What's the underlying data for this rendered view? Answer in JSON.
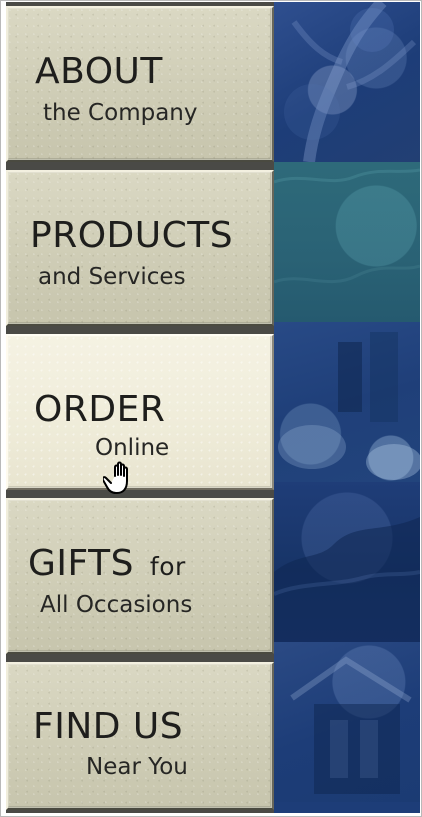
{
  "nav": {
    "items": [
      {
        "title": "ABOUT",
        "subtitle": "the Company"
      },
      {
        "title": "PRODUCTS",
        "subtitle": "and Services"
      },
      {
        "title": "ORDER",
        "subtitle": "Online"
      },
      {
        "title": "GIFTS",
        "title_suffix": "for",
        "subtitle": "All Occasions"
      },
      {
        "title": "FIND US",
        "subtitle": "Near You"
      }
    ],
    "active_index": 2
  },
  "colors": {
    "button_base": "#cfcdb6",
    "button_active": "#efecd9",
    "text": "#1e1e1c",
    "photo_panel_blue": "#1d3d78",
    "photo_panel_teal": "#2e6a7a"
  },
  "icons": {
    "cursor": "hand-pointer-icon"
  }
}
